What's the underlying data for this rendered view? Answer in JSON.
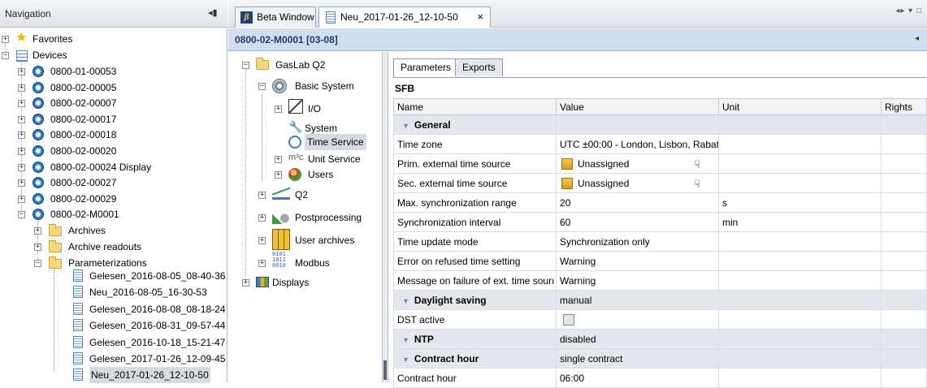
{
  "navigation": {
    "title": "Navigation",
    "pin_glyph": "◂▮",
    "favorites": "Favorites",
    "devices": "Devices",
    "device_items": [
      "0800-01-00053",
      "0800-02-00005",
      "0800-02-00007",
      "0800-02-00017",
      "0800-02-00018",
      "0800-02-00020",
      "0800-02-00024 Display",
      "0800-02-00027",
      "0800-02-00029",
      "0800-02-M0001"
    ],
    "sub_items": [
      "Archives",
      "Archive readouts",
      "Parameterizations"
    ],
    "param_files": [
      "Gelesen_2016-08-05_08-40-36",
      "Neu_2016-08-05_16-30-53",
      "Gelesen_2016-08-08_08-18-24",
      "Gelesen_2016-08-31_09-57-44",
      "Gelesen_2016-10-18_15-21-47",
      "Gelesen_2017-01-26_12-09-45",
      "Neu_2017-01-26_12-10-50"
    ]
  },
  "tabs": {
    "beta": "Beta Window",
    "active": "Neu_2017-01-26_12-10-50",
    "close": "×",
    "controls": "◂▸ ▾ □"
  },
  "breadcrumb": {
    "text": "0800-02-M0001 [03-08]",
    "arrow": "◂"
  },
  "tree": {
    "root": "GasLab Q2",
    "basic_system": "Basic System",
    "io": "I/O",
    "system": "System",
    "time_service": "Time Service",
    "unit_service": "Unit Service",
    "users": "Users",
    "q2": "Q2",
    "postprocessing": "Postprocessing",
    "user_archives": "User archives",
    "modbus": "Modbus",
    "displays": "Displays"
  },
  "panel": {
    "tab_parameters": "Parameters",
    "tab_exports": "Exports",
    "section": "SFB",
    "columns": [
      "Name",
      "Value",
      "Unit",
      "Rights"
    ],
    "rows": [
      {
        "type": "group",
        "name": "General",
        "value": ""
      },
      {
        "type": "row",
        "name": "Time zone",
        "value": "UTC ±00:00 - London, Lisbon, Rabat",
        "unit": ""
      },
      {
        "type": "assign",
        "name": "Prim. external time source",
        "value": "Unassigned",
        "unit": ""
      },
      {
        "type": "assign",
        "name": "Sec. external time source",
        "value": "Unassigned",
        "unit": ""
      },
      {
        "type": "row",
        "name": "Max. synchronization range",
        "value": "20",
        "unit": "s"
      },
      {
        "type": "row",
        "name": "Synchronization interval",
        "value": "60",
        "unit": "min"
      },
      {
        "type": "row",
        "name": "Time update mode",
        "value": "Synchronization only",
        "unit": ""
      },
      {
        "type": "row",
        "name": "Error on refused time setting",
        "value": "Warning",
        "unit": ""
      },
      {
        "type": "row",
        "name": "Message on failure of ext. time sourı",
        "value": "Warning",
        "unit": ""
      },
      {
        "type": "group",
        "name": "Daylight saving",
        "value": "manual"
      },
      {
        "type": "check",
        "name": "DST active",
        "value": "",
        "unit": ""
      },
      {
        "type": "group",
        "name": "NTP",
        "value": "disabled"
      },
      {
        "type": "group",
        "name": "Contract hour",
        "value": "single contract"
      },
      {
        "type": "row",
        "name": "Contract hour",
        "value": "06:00",
        "unit": ""
      }
    ]
  }
}
